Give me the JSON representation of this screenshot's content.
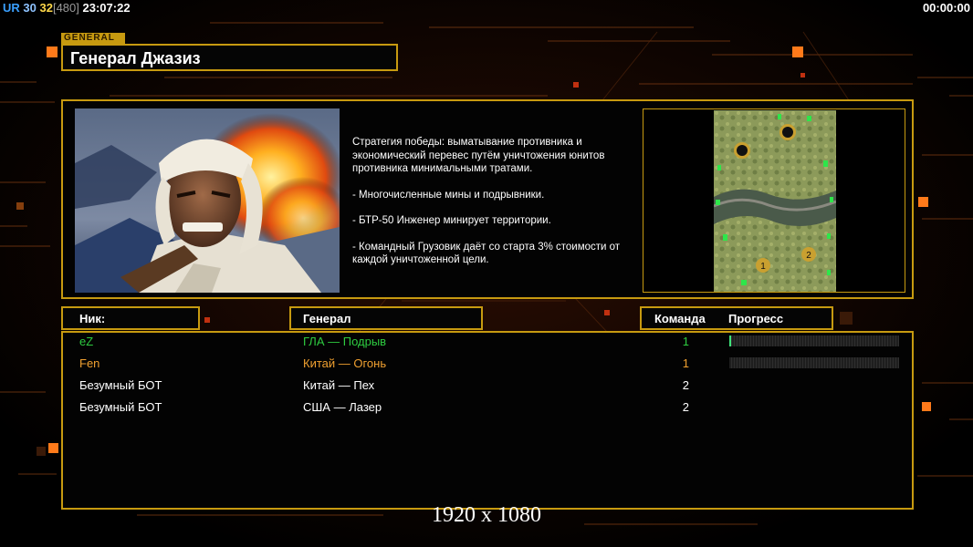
{
  "hud": {
    "ur": "UR",
    "v1": "30",
    "v2": "32",
    "v3": "[480]",
    "clock": "23:07:22",
    "timer": "00:00:00"
  },
  "general": {
    "tag": "GENERAL",
    "name": "Генерал Джазиз",
    "description": [
      "Стратегия победы: выматывание противника и экономический перевес путём уничтожения юнитов противника минимальными тратами.",
      "- Многочисленные мины и подрывники.",
      "- БТР-50 Инженер минирует территории.",
      "- Командный Грузовик даёт со старта 3% стоимости от каждой уничтоженной цели."
    ]
  },
  "headers": {
    "nick": "Ник:",
    "general": "Генерал",
    "team": "Команда",
    "progress": "Прогресс"
  },
  "players": [
    {
      "nick": "eZ",
      "general": "ГЛА — Подрыв",
      "team": "1",
      "color": "#2ecc40",
      "progress": 0.01,
      "show_progress": true
    },
    {
      "nick": "Fen",
      "general": "Китай — Огонь",
      "team": "1",
      "color": "#f0a030",
      "progress": 0.0,
      "show_progress": true
    },
    {
      "nick": "Безумный БОТ",
      "general": "Китай — Пех",
      "team": "2",
      "color": "#ffffff",
      "progress": 0.0,
      "show_progress": false
    },
    {
      "nick": "Безумный БОТ",
      "general": "США — Лазер",
      "team": "2",
      "color": "#ffffff",
      "progress": 0.0,
      "show_progress": false
    }
  ],
  "map": {
    "player_markers": [
      "1",
      "2"
    ]
  },
  "resolution_label": "1920 x 1080",
  "colors": {
    "frame": "#c79a10",
    "accent_orange": "#ff7a1a"
  }
}
